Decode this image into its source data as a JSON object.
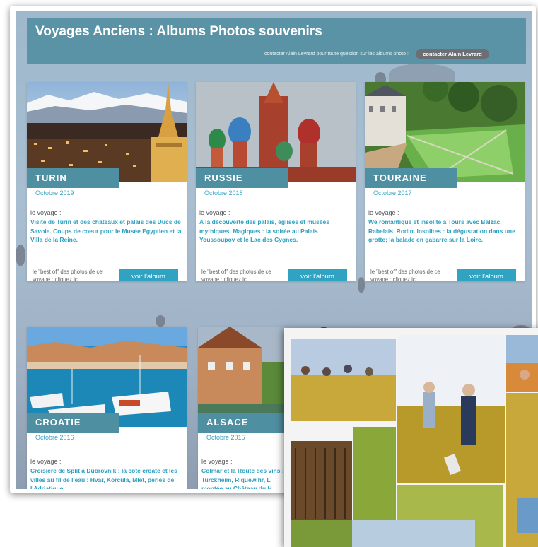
{
  "header": {
    "title": "Voyages Anciens  : Albums Photos souvenirs",
    "contact_text": "contacter Alain Levrard pour toute question sur les albums photo  :",
    "contact_button": "contacter Alain Levrard"
  },
  "cards": [
    {
      "name": "TURIN",
      "date": "Octobre 2019",
      "intro": "le voyage :",
      "description": "Visite de Turin et des châteaux et palais des Ducs de Savoie. Coups de coeur pour le Musée Egyptien et la Villa de la Reine.",
      "best_of": "le \"best of\" des photos de ce voyage : cliquez ici",
      "button": "voir l'album"
    },
    {
      "name": "RUSSIE",
      "date": "Octobre 2018",
      "intro": "le voyage :",
      "description": "A la découverte des palais, églises et musées mythiques. Magiques : la soirée au Palais Youssoupov et le Lac des Cygnes.",
      "best_of": "le \"best of\" des photos de ce voyage : cliquez ici",
      "button": "voir l'album"
    },
    {
      "name": "TOURAINE",
      "date": "Octobre 2017",
      "intro": "le voyage :",
      "description": "We romantique et insolite à Tours avec Balzac, Rabelais, Rodin. Insolites : la dégustation dans une grotte; la balade en gabarre sur la Loire.",
      "best_of": "le \"best of\" des photos de ce voyage : cliquez ici",
      "button": "voir l'album"
    },
    {
      "name": "CROATIE",
      "date": "Octobre 2016",
      "intro": "le voyage :",
      "description": "Croisière de Split à Dubrovnik : la côte croate et les villes au fil de l'eau : Hvar, Korcula, Mlet, perles de l'Adriatique.",
      "best_of": "",
      "button": ""
    },
    {
      "name": "ALSACE",
      "date": "Octobre 2015",
      "intro": "le voyage :",
      "description": "Colmar et la Route des vins : Turckheim, Riquewihr, L montée au Château du H",
      "best_of": "",
      "button": ""
    }
  ],
  "colors": {
    "header": "#5a93a6",
    "tag": "#4f8fa2",
    "button": "#2fa3c1",
    "date": "#3aa5c4"
  }
}
